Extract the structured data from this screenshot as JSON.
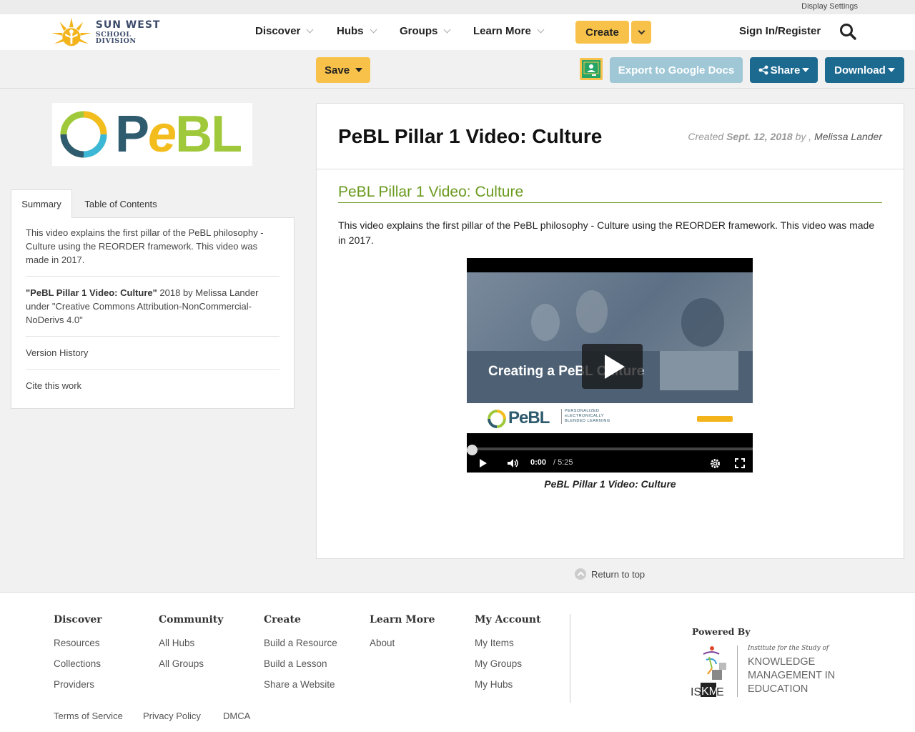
{
  "utility": {
    "display_settings": "Display Settings"
  },
  "brand": {
    "line1": "SUN WEST",
    "line2": "SCHOOL DIVISION"
  },
  "nav": {
    "discover": "Discover",
    "hubs": "Hubs",
    "groups": "Groups",
    "learn_more": "Learn More",
    "create": "Create",
    "sign_in": "Sign In/Register"
  },
  "toolbar": {
    "save": "Save",
    "export": "Export to Google Docs",
    "share": "Share",
    "download": "Download"
  },
  "sidebar": {
    "logo_text": {
      "p": "P",
      "e": "e",
      "bl": "BL"
    },
    "tabs": [
      "Summary",
      "Table of Contents"
    ],
    "summary": "This video explains the first pillar of the PeBL philosophy - Culture using the REORDER framework. This video was made in 2017.",
    "license_title": "\"PeBL Pillar 1 Video: Culture\"",
    "license_rest": " 2018 by Melissa Lander under \"Creative Commons Attribution-NonCommercial-NoDerivs 4.0\"",
    "version_history": "Version History",
    "cite": "Cite this work"
  },
  "main": {
    "title": "PeBL Pillar 1 Video: Culture",
    "meta_created": "Created ",
    "meta_date": "Sept. 12, 2018",
    "meta_by": " by , ",
    "meta_author": "Melissa Lander",
    "section_title": "PeBL Pillar 1 Video: Culture",
    "description": "This video explains the first pillar of the PeBL philosophy - Culture using the REORDER framework.  This video was made in 2017.",
    "video": {
      "overlay_title": "Creating a PeBL Culture",
      "banner_logo": "PeBL",
      "banner_tagline": "PERSONALIZED eLECTRONICALLY BLENDED LEARNING",
      "current_time": "0:00",
      "duration": "/ 5:25",
      "progress": 0
    },
    "caption": "PeBL Pillar 1 Video: Culture",
    "return_top": "Return to top"
  },
  "footer": {
    "columns": [
      {
        "heading": "Discover",
        "links": [
          "Resources",
          "Collections",
          "Providers"
        ]
      },
      {
        "heading": "Community",
        "links": [
          "All Hubs",
          "All Groups"
        ]
      },
      {
        "heading": "Create",
        "links": [
          "Build a Resource",
          "Build a Lesson",
          "Share a Website"
        ]
      },
      {
        "heading": "Learn More",
        "links": [
          "About"
        ]
      },
      {
        "heading": "My Account",
        "links": [
          "My Items",
          "My Groups",
          "My Hubs"
        ]
      }
    ],
    "powered_by": "Powered By",
    "iskme": {
      "tag": "Institute for the Study of",
      "line1": "KNOWLEDGE",
      "line2": "MANAGEMENT IN",
      "line3": "EDUCATION",
      "acronym_is": "IS",
      "acronym_km": "KM",
      "acronym_e": "E"
    },
    "legal": [
      "Terms of Service",
      "Privacy Policy",
      "DMCA"
    ]
  },
  "colors": {
    "accent_yellow": "#f8c149",
    "primary_blue": "#1d6a90",
    "export_disabled": "#9fc7d6",
    "title_green": "#6a9a1f",
    "pebl_teal": "#2f5b6e",
    "pebl_yellow": "#f3bd1e",
    "pebl_lime": "#9fc83a",
    "pebl_cyan": "#3cb8d6"
  }
}
